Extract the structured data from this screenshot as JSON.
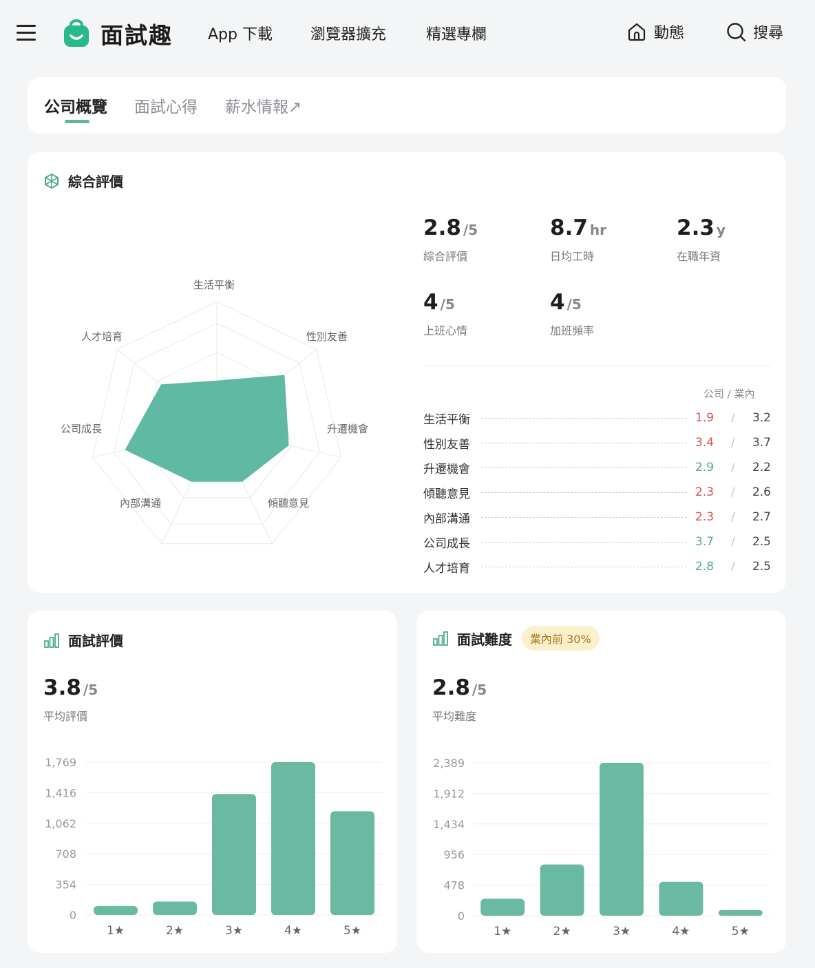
{
  "header": {
    "brand": "面試趣",
    "nav": [
      "App 下載",
      "瀏覽器擴充",
      "精選專欄"
    ],
    "feed_label": "動態",
    "search_label": "搜尋"
  },
  "tabs": [
    {
      "label": "公司概覽",
      "active": true
    },
    {
      "label": "面試心得",
      "active": false
    },
    {
      "label": "薪水情報↗",
      "active": false
    }
  ],
  "overview": {
    "title": "綜合評價",
    "stats": [
      {
        "value": "2.8",
        "unit": "/5",
        "label": "綜合評價"
      },
      {
        "value": "8.7",
        "unit": "hr",
        "label": "日均工時"
      },
      {
        "value": "2.3",
        "unit": "y",
        "label": "在職年資"
      },
      {
        "value": "4",
        "unit": "/5",
        "label": "上班心情"
      },
      {
        "value": "4",
        "unit": "/5",
        "label": "加班頻率"
      }
    ],
    "comparison_header": "公司 / 業內",
    "comparison": [
      {
        "name": "生活平衡",
        "company": "1.9",
        "industry": "3.2",
        "status": "red"
      },
      {
        "name": "性別友善",
        "company": "3.4",
        "industry": "3.7",
        "status": "red"
      },
      {
        "name": "升遷機會",
        "company": "2.9",
        "industry": "2.2",
        "status": "green"
      },
      {
        "name": "傾聽意見",
        "company": "2.3",
        "industry": "2.6",
        "status": "red"
      },
      {
        "name": "內部溝通",
        "company": "2.3",
        "industry": "2.7",
        "status": "red"
      },
      {
        "name": "公司成長",
        "company": "3.7",
        "industry": "2.5",
        "status": "green"
      },
      {
        "name": "人才培育",
        "company": "2.8",
        "industry": "2.5",
        "status": "green"
      }
    ],
    "radar": {
      "axes": [
        "生活平衡",
        "性別友善",
        "升遷機會",
        "傾聽意見",
        "內部溝通",
        "公司成長",
        "人才培育"
      ],
      "values": [
        1.9,
        3.4,
        2.9,
        2.3,
        2.3,
        3.7,
        2.8
      ],
      "max": 5,
      "fill_color": "#5fb9a3"
    }
  },
  "interview_rating": {
    "title": "面試評價",
    "value": "3.8",
    "unit": "/5",
    "label": "平均評價"
  },
  "interview_difficulty": {
    "title": "面試難度",
    "badge": "業內前 30%",
    "value": "2.8",
    "unit": "/5",
    "label": "平均難度"
  },
  "chart_data": [
    {
      "type": "bar",
      "categories": [
        "1★",
        "2★",
        "3★",
        "4★",
        "5★"
      ],
      "values": [
        105,
        155,
        1400,
        1769,
        1200
      ],
      "yticks": [
        "0",
        "354",
        "708",
        "1,062",
        "1,416",
        "1,769"
      ],
      "ylim": [
        0,
        1769
      ],
      "color": "#6ab9a3"
    },
    {
      "type": "bar",
      "categories": [
        "1★",
        "2★",
        "3★",
        "4★",
        "5★"
      ],
      "values": [
        265,
        800,
        2389,
        530,
        55
      ],
      "yticks": [
        "0",
        "478",
        "956",
        "1,434",
        "1,912",
        "2,389"
      ],
      "ylim": [
        0,
        2389
      ],
      "color": "#6ab9a3"
    }
  ]
}
